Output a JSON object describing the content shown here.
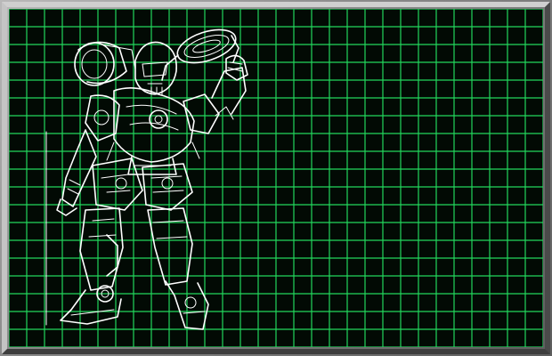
{
  "screen": {
    "grid_color": "#22d65c",
    "background_color": "#020a04",
    "line_color": "#ffffff",
    "frame_color": "#8a8a8a"
  },
  "blueprint": {
    "subject": "mech-robot-line-art"
  }
}
